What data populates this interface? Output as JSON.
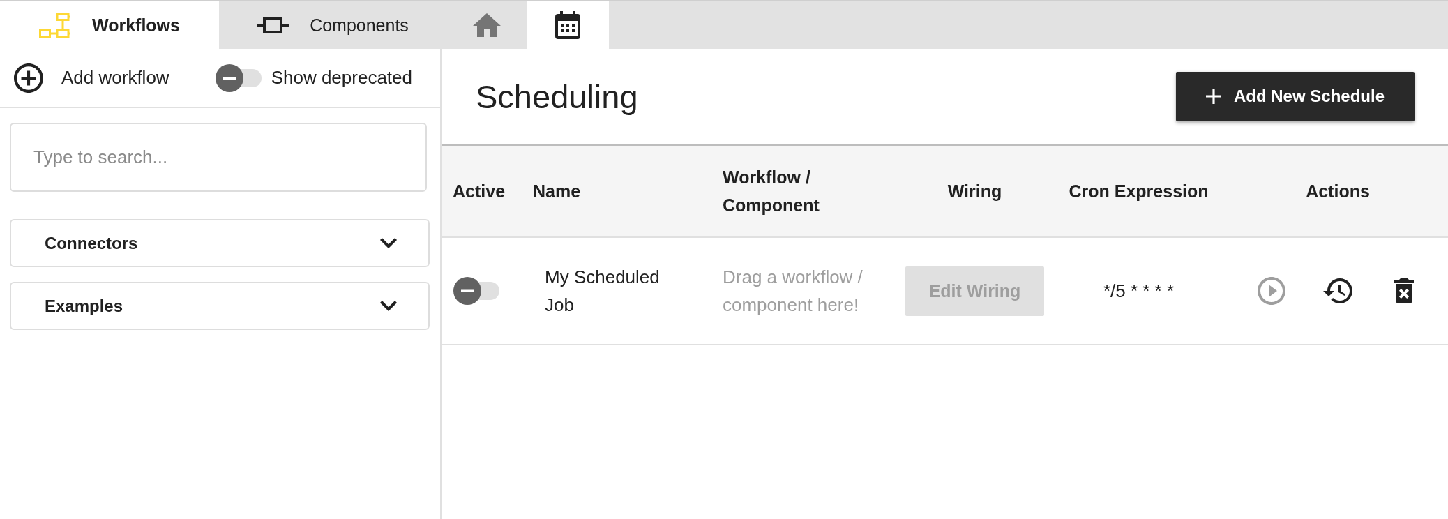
{
  "tabs": [
    {
      "label": "Workflows",
      "selected": true
    },
    {
      "label": "Components",
      "selected": false
    },
    {
      "selected": false
    },
    {
      "selected": true
    }
  ],
  "sidebar": {
    "add_button": "Add workflow",
    "deprecated_toggle": {
      "label": "Show deprecated",
      "on": false
    },
    "search": {
      "placeholder": "Type to search..."
    },
    "sections": [
      {
        "label": "Connectors",
        "expanded": false
      },
      {
        "label": "Examples",
        "expanded": false
      }
    ]
  },
  "main": {
    "title": "Scheduling",
    "add_button": "Add New Schedule",
    "table": {
      "columns": [
        "Active",
        "Name",
        "Workflow / Component",
        "Wiring",
        "Cron Expression",
        "Actions"
      ],
      "rows": [
        {
          "active": false,
          "name": "My Scheduled Job",
          "workflow": {
            "placeholder": "Drag a workflow / component here!"
          },
          "wiring": {
            "label": "Edit Wiring",
            "disabled": true
          },
          "cron": "*/5 * * * *",
          "actions": [
            {
              "kind": "run",
              "disabled": true
            },
            {
              "kind": "history",
              "disabled": false
            },
            {
              "kind": "delete",
              "disabled": false
            }
          ]
        }
      ]
    }
  }
}
